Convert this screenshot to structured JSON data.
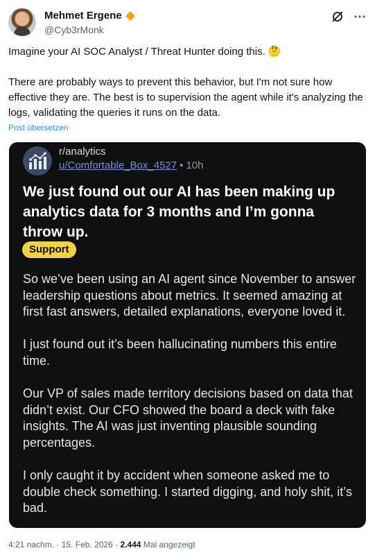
{
  "author": {
    "name": "Mehmet Ergene",
    "handle": "@Cyb3rMonk"
  },
  "tweet": {
    "paragraphs": [
      "Imagine your AI SOC Analyst / Threat Hunter doing this. 🤔",
      "There are probably ways to prevent this behavior, but I'm not sure how effective they are. The best is to supervision the agent while it's analyzing the logs, validating the queries it runs on the data."
    ],
    "translate_label": "Post übersetzen"
  },
  "embedded_post": {
    "subreddit": "r/analytics",
    "username": "u/Comfortable_Box_4527",
    "separator": "•",
    "age": "10h",
    "title": "We just found out our AI has been making up analytics data for 3 months and I’m gonna throw up.",
    "flair": "Support",
    "body": [
      "So we’ve been using an AI agent since November to answer leadership questions about metrics. It seemed amazing at first fast answers, detailed explanations, everyone loved it.",
      "I just found out it’s been hallucinating numbers this entire time.",
      "Our VP of sales made territory decisions based on data that didn’t exist. Our CFO showed the board a deck with fake insights. The AI was just inventing plausible sounding percentages.",
      "I only caught it by accident when someone asked me to double check something. I started digging, and holy shit, it’s bad."
    ]
  },
  "footer": {
    "time": "4:21 nachm.",
    "sep": " · ",
    "date": "15. Feb. 2026",
    "views": "2.444",
    "views_label": "Mal angezeigt"
  },
  "colors": {
    "link_blue": "#1d9bf0",
    "card_bg": "#0e0f11",
    "flair_yellow": "#f2d245",
    "verified_orange": "#f4a30c",
    "reddit_user_link": "#7b8fd6"
  },
  "icons": [
    "grok-icon",
    "more-icon",
    "analytics-chart-icon",
    "verified-badge-icon"
  ]
}
